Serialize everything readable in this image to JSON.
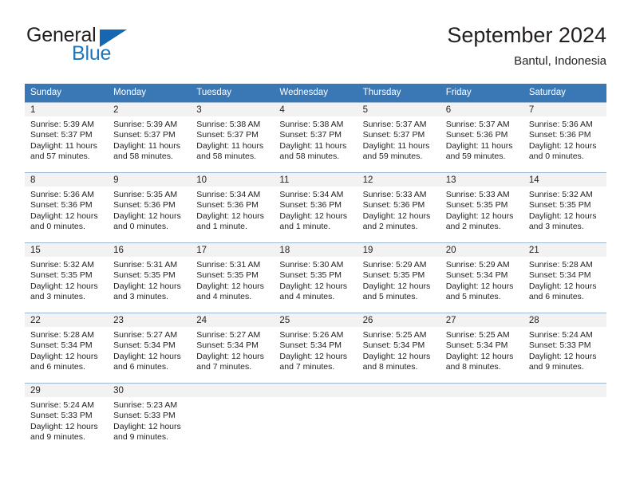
{
  "brand": {
    "name_part1": "General",
    "name_part2": "Blue",
    "triangle_icon": "triangle-icon",
    "color_dark": "#231f20",
    "color_blue": "#1e76bd"
  },
  "header": {
    "title": "September 2024",
    "location": "Bantul, Indonesia"
  },
  "theme": {
    "header_bg": "#3a77b5",
    "daynum_bg": "#f2f2f2",
    "grid_line": "#9bb7d4",
    "text": "#231f20"
  },
  "weekdays": [
    "Sunday",
    "Monday",
    "Tuesday",
    "Wednesday",
    "Thursday",
    "Friday",
    "Saturday"
  ],
  "weeks": [
    [
      {
        "day": "1",
        "sunrise": "Sunrise: 5:39 AM",
        "sunset": "Sunset: 5:37 PM",
        "daylight": "Daylight: 11 hours and 57 minutes."
      },
      {
        "day": "2",
        "sunrise": "Sunrise: 5:39 AM",
        "sunset": "Sunset: 5:37 PM",
        "daylight": "Daylight: 11 hours and 58 minutes."
      },
      {
        "day": "3",
        "sunrise": "Sunrise: 5:38 AM",
        "sunset": "Sunset: 5:37 PM",
        "daylight": "Daylight: 11 hours and 58 minutes."
      },
      {
        "day": "4",
        "sunrise": "Sunrise: 5:38 AM",
        "sunset": "Sunset: 5:37 PM",
        "daylight": "Daylight: 11 hours and 58 minutes."
      },
      {
        "day": "5",
        "sunrise": "Sunrise: 5:37 AM",
        "sunset": "Sunset: 5:37 PM",
        "daylight": "Daylight: 11 hours and 59 minutes."
      },
      {
        "day": "6",
        "sunrise": "Sunrise: 5:37 AM",
        "sunset": "Sunset: 5:36 PM",
        "daylight": "Daylight: 11 hours and 59 minutes."
      },
      {
        "day": "7",
        "sunrise": "Sunrise: 5:36 AM",
        "sunset": "Sunset: 5:36 PM",
        "daylight": "Daylight: 12 hours and 0 minutes."
      }
    ],
    [
      {
        "day": "8",
        "sunrise": "Sunrise: 5:36 AM",
        "sunset": "Sunset: 5:36 PM",
        "daylight": "Daylight: 12 hours and 0 minutes."
      },
      {
        "day": "9",
        "sunrise": "Sunrise: 5:35 AM",
        "sunset": "Sunset: 5:36 PM",
        "daylight": "Daylight: 12 hours and 0 minutes."
      },
      {
        "day": "10",
        "sunrise": "Sunrise: 5:34 AM",
        "sunset": "Sunset: 5:36 PM",
        "daylight": "Daylight: 12 hours and 1 minute."
      },
      {
        "day": "11",
        "sunrise": "Sunrise: 5:34 AM",
        "sunset": "Sunset: 5:36 PM",
        "daylight": "Daylight: 12 hours and 1 minute."
      },
      {
        "day": "12",
        "sunrise": "Sunrise: 5:33 AM",
        "sunset": "Sunset: 5:36 PM",
        "daylight": "Daylight: 12 hours and 2 minutes."
      },
      {
        "day": "13",
        "sunrise": "Sunrise: 5:33 AM",
        "sunset": "Sunset: 5:35 PM",
        "daylight": "Daylight: 12 hours and 2 minutes."
      },
      {
        "day": "14",
        "sunrise": "Sunrise: 5:32 AM",
        "sunset": "Sunset: 5:35 PM",
        "daylight": "Daylight: 12 hours and 3 minutes."
      }
    ],
    [
      {
        "day": "15",
        "sunrise": "Sunrise: 5:32 AM",
        "sunset": "Sunset: 5:35 PM",
        "daylight": "Daylight: 12 hours and 3 minutes."
      },
      {
        "day": "16",
        "sunrise": "Sunrise: 5:31 AM",
        "sunset": "Sunset: 5:35 PM",
        "daylight": "Daylight: 12 hours and 3 minutes."
      },
      {
        "day": "17",
        "sunrise": "Sunrise: 5:31 AM",
        "sunset": "Sunset: 5:35 PM",
        "daylight": "Daylight: 12 hours and 4 minutes."
      },
      {
        "day": "18",
        "sunrise": "Sunrise: 5:30 AM",
        "sunset": "Sunset: 5:35 PM",
        "daylight": "Daylight: 12 hours and 4 minutes."
      },
      {
        "day": "19",
        "sunrise": "Sunrise: 5:29 AM",
        "sunset": "Sunset: 5:35 PM",
        "daylight": "Daylight: 12 hours and 5 minutes."
      },
      {
        "day": "20",
        "sunrise": "Sunrise: 5:29 AM",
        "sunset": "Sunset: 5:34 PM",
        "daylight": "Daylight: 12 hours and 5 minutes."
      },
      {
        "day": "21",
        "sunrise": "Sunrise: 5:28 AM",
        "sunset": "Sunset: 5:34 PM",
        "daylight": "Daylight: 12 hours and 6 minutes."
      }
    ],
    [
      {
        "day": "22",
        "sunrise": "Sunrise: 5:28 AM",
        "sunset": "Sunset: 5:34 PM",
        "daylight": "Daylight: 12 hours and 6 minutes."
      },
      {
        "day": "23",
        "sunrise": "Sunrise: 5:27 AM",
        "sunset": "Sunset: 5:34 PM",
        "daylight": "Daylight: 12 hours and 6 minutes."
      },
      {
        "day": "24",
        "sunrise": "Sunrise: 5:27 AM",
        "sunset": "Sunset: 5:34 PM",
        "daylight": "Daylight: 12 hours and 7 minutes."
      },
      {
        "day": "25",
        "sunrise": "Sunrise: 5:26 AM",
        "sunset": "Sunset: 5:34 PM",
        "daylight": "Daylight: 12 hours and 7 minutes."
      },
      {
        "day": "26",
        "sunrise": "Sunrise: 5:25 AM",
        "sunset": "Sunset: 5:34 PM",
        "daylight": "Daylight: 12 hours and 8 minutes."
      },
      {
        "day": "27",
        "sunrise": "Sunrise: 5:25 AM",
        "sunset": "Sunset: 5:34 PM",
        "daylight": "Daylight: 12 hours and 8 minutes."
      },
      {
        "day": "28",
        "sunrise": "Sunrise: 5:24 AM",
        "sunset": "Sunset: 5:33 PM",
        "daylight": "Daylight: 12 hours and 9 minutes."
      }
    ],
    [
      {
        "day": "29",
        "sunrise": "Sunrise: 5:24 AM",
        "sunset": "Sunset: 5:33 PM",
        "daylight": "Daylight: 12 hours and 9 minutes."
      },
      {
        "day": "30",
        "sunrise": "Sunrise: 5:23 AM",
        "sunset": "Sunset: 5:33 PM",
        "daylight": "Daylight: 12 hours and 9 minutes."
      },
      {
        "day": "",
        "sunrise": "",
        "sunset": "",
        "daylight": ""
      },
      {
        "day": "",
        "sunrise": "",
        "sunset": "",
        "daylight": ""
      },
      {
        "day": "",
        "sunrise": "",
        "sunset": "",
        "daylight": ""
      },
      {
        "day": "",
        "sunrise": "",
        "sunset": "",
        "daylight": ""
      },
      {
        "day": "",
        "sunrise": "",
        "sunset": "",
        "daylight": ""
      }
    ]
  ]
}
